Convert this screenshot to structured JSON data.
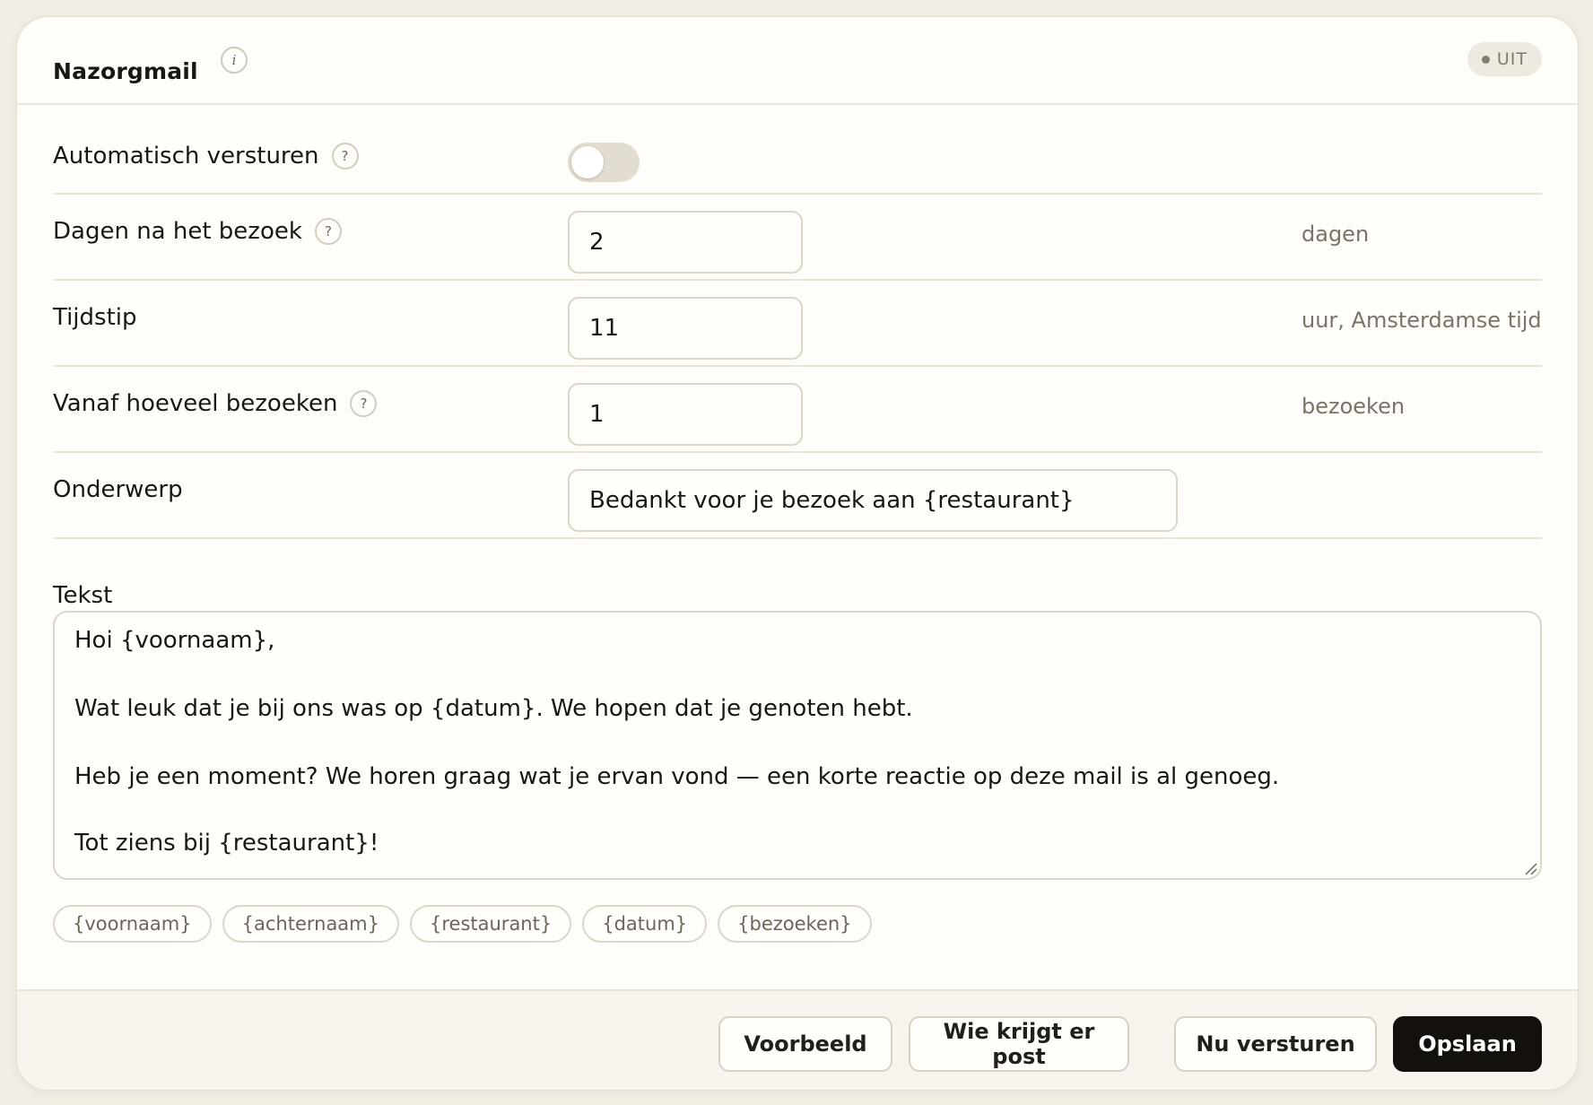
{
  "header": {
    "title": "Nazorgmail",
    "info_icon": "i",
    "status": "UIT"
  },
  "settings": {
    "auto_send": {
      "label": "Automatisch versturen",
      "help": "?",
      "enabled": false
    },
    "days_after": {
      "label": "Dagen na het bezoek",
      "help": "?",
      "value": "2",
      "unit": "dagen"
    },
    "time": {
      "label": "Tijdstip",
      "value": "11",
      "unit": "uur, Amsterdamse tijd"
    },
    "min_visits": {
      "label": "Vanaf hoeveel bezoeken",
      "help": "?",
      "value": "1",
      "unit": "bezoeken"
    },
    "subject": {
      "label": "Onderwerp",
      "value": "Bedankt voor je bezoek aan {restaurant}"
    }
  },
  "body_text": {
    "label": "Tekst",
    "lines": [
      "Hoi {voornaam},",
      "Wat leuk dat je bij ons was op {datum}. We hopen dat je genoten hebt.",
      "Heb je een moment? We horen graag wat je ervan vond — een korte reactie op deze mail is al genoeg.",
      "Tot ziens bij {restaurant}!"
    ]
  },
  "placeholders": [
    "{voornaam}",
    "{achternaam}",
    "{restaurant}",
    "{datum}",
    "{bezoeken}"
  ],
  "footer": {
    "preview": "Voorbeeld",
    "recipients": "Wie krijgt er post",
    "send_now": "Nu versturen",
    "save": "Opslaan"
  },
  "colors": {
    "background": "#f1ede4",
    "card": "#fefdf9",
    "primary_button": "#14110d",
    "muted_text": "#7c7367"
  }
}
